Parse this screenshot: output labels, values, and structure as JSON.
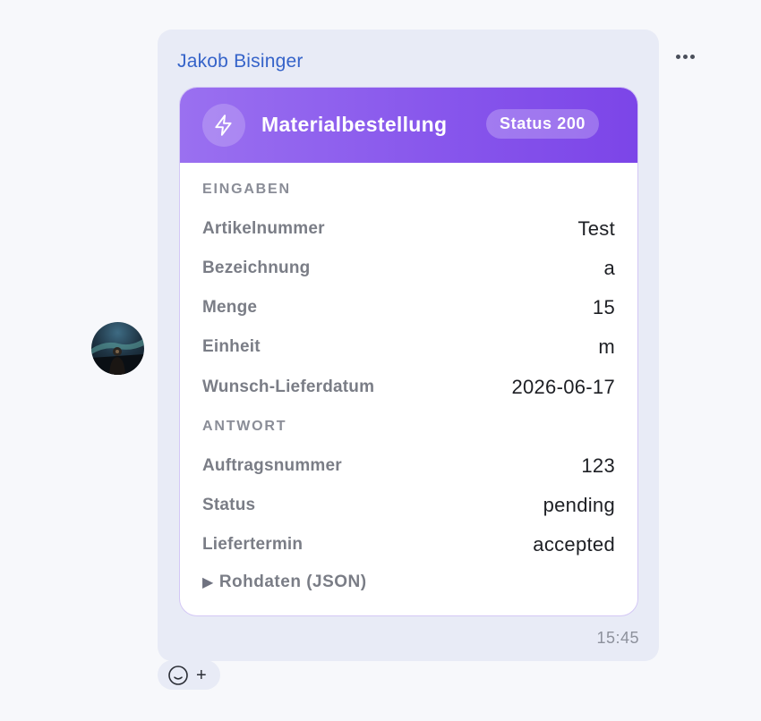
{
  "message": {
    "sender": "Jakob Bisinger",
    "time": "15:45",
    "avatar_icon": "user-photo",
    "more_icon": "more-horizontal-icon"
  },
  "card": {
    "title": "Materialbestellung",
    "status_badge": "Status 200",
    "icon": "lightning-bolt-icon",
    "accent_color": "#8a55ec",
    "inputs_label": "EINGABEN",
    "inputs": [
      {
        "key": "Artikelnummer",
        "value": "Test"
      },
      {
        "key": "Bezeichnung",
        "value": "a"
      },
      {
        "key": "Menge",
        "value": "15"
      },
      {
        "key": "Einheit",
        "value": "m"
      },
      {
        "key": "Wunsch-Lieferdatum",
        "value": "2026-06-17"
      }
    ],
    "response_label": "ANTWORT",
    "response": [
      {
        "key": "Auftragsnummer",
        "value": "123"
      },
      {
        "key": "Status",
        "value": "pending"
      },
      {
        "key": "Liefertermin",
        "value": "accepted"
      }
    ],
    "raw_toggle_label": "Rohdaten (JSON)",
    "raw_toggle_marker": "▶"
  },
  "reaction": {
    "icon": "smiley-icon",
    "plus_label": "+"
  }
}
